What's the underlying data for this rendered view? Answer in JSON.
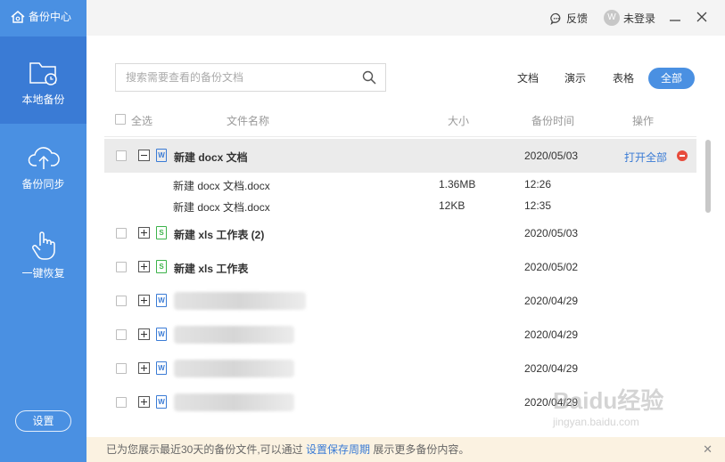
{
  "app": {
    "title": "备份中心"
  },
  "sidebar": {
    "items": [
      {
        "label": "本地备份",
        "icon": "folder-clock-icon",
        "active": true
      },
      {
        "label": "备份同步",
        "icon": "cloud-upload-icon",
        "active": false
      },
      {
        "label": "一键恢复",
        "icon": "hand-pointer-icon",
        "active": false
      }
    ],
    "settings_label": "设置"
  },
  "topbar": {
    "feedback_label": "反馈",
    "user_label": "未登录"
  },
  "search": {
    "placeholder": "搜索需要查看的备份文档"
  },
  "filters": [
    "文档",
    "演示",
    "表格",
    "全部"
  ],
  "filter_active": "全部",
  "table": {
    "select_all": "全选",
    "headers": {
      "name": "文件名称",
      "size": "大小",
      "time": "备份时间",
      "action": "操作"
    },
    "rows": [
      {
        "name": "新建 docx 文档",
        "date": "2020/05/03",
        "type": "word",
        "expanded": true,
        "action": "打开全部",
        "children": [
          {
            "name": "新建 docx 文档.docx",
            "size": "1.36MB",
            "time": "12:26"
          },
          {
            "name": "新建 docx 文档.docx",
            "size": "12KB",
            "time": "12:35"
          }
        ]
      },
      {
        "name": "新建 xls 工作表 (2)",
        "date": "2020/05/03",
        "type": "xls"
      },
      {
        "name": "新建 xls 工作表",
        "date": "2020/05/02",
        "type": "xls"
      },
      {
        "name": "",
        "date": "2020/04/29",
        "type": "word"
      },
      {
        "name": "",
        "date": "2020/04/29",
        "type": "word"
      },
      {
        "name": "",
        "date": "2020/04/29",
        "type": "word"
      },
      {
        "name": "",
        "date": "2020/04/29",
        "type": "word"
      }
    ]
  },
  "footer": {
    "text_before": "已为您展示最近30天的备份文件,可以通过",
    "link": "设置保存周期",
    "text_after": "展示更多备份内容。"
  },
  "watermark": {
    "brand": "Baidu经验",
    "url": "jingyan.baidu.com"
  },
  "colors": {
    "accent": "#4a90e2",
    "sidebar_active": "#3a7bd5",
    "delete": "#e74c3c",
    "footer_bg": "#fbf2e1"
  }
}
